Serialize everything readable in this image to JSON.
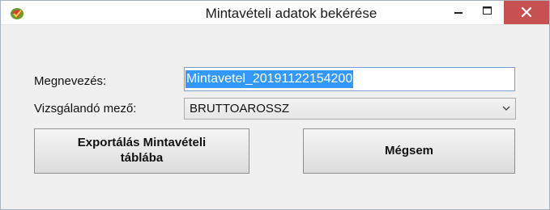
{
  "window": {
    "title": "Mintavételi adatok bekérése",
    "icons": {
      "app": "app-icon",
      "minimize": "minimize-icon",
      "maximize": "maximize-icon",
      "close": "close-icon"
    },
    "colors": {
      "close_button": "#c75050",
      "selection": "#3399ff"
    }
  },
  "form": {
    "name_label": "Megnevezés:",
    "name_value": "Mintavetel_20191122154200",
    "field_label": "Vizsgálandó mező:",
    "field_value": "BRUTTOAROSSZ",
    "field_icon": "chevron-down-icon"
  },
  "buttons": {
    "export_line1": "Exportálás Mintavételi",
    "export_line2": "táblába",
    "cancel": "Mégsem"
  }
}
